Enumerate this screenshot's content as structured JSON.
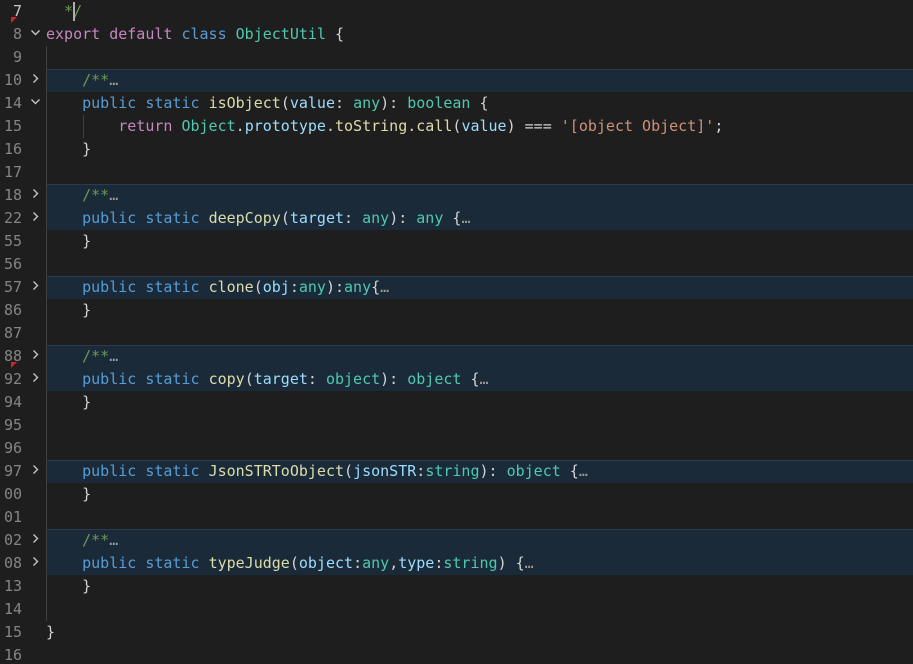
{
  "editor": {
    "language": "typescript",
    "colors": {
      "background": "#1e1e1e",
      "folded_highlight": "#1b2a38",
      "keyword": "#569cd6",
      "control": "#c586c0",
      "class": "#4ec9b0",
      "function": "#dcdcaa",
      "parameter": "#9cdcfe",
      "string": "#ce9178",
      "comment": "#6a9955",
      "line_number": "#858585"
    },
    "lines": [
      {
        "num": "7",
        "fold": "",
        "tokens": [
          [
            "cm",
            "  */"
          ]
        ]
      },
      {
        "num": "8",
        "fold": "expanded",
        "tokens": [
          [
            "ctl",
            "export"
          ],
          [
            "pun",
            " "
          ],
          [
            "ctl",
            "default"
          ],
          [
            "pun",
            " "
          ],
          [
            "kw",
            "class"
          ],
          [
            "pun",
            " "
          ],
          [
            "cls",
            "ObjectUtil"
          ],
          [
            "pun",
            " {"
          ]
        ]
      },
      {
        "num": "9",
        "fold": "",
        "tokens": []
      },
      {
        "num": "10",
        "fold": "collapsed",
        "tokens": [
          [
            "pun",
            "    "
          ],
          [
            "cm",
            "/**"
          ],
          [
            "ell",
            "…"
          ]
        ]
      },
      {
        "num": "14",
        "fold": "expanded",
        "tokens": [
          [
            "pun",
            "    "
          ],
          [
            "kw",
            "public"
          ],
          [
            "pun",
            " "
          ],
          [
            "kw",
            "static"
          ],
          [
            "pun",
            " "
          ],
          [
            "fn",
            "isObject"
          ],
          [
            "pun",
            "("
          ],
          [
            "par",
            "value"
          ],
          [
            "pun",
            ": "
          ],
          [
            "typ",
            "any"
          ],
          [
            "pun",
            "): "
          ],
          [
            "typ",
            "boolean"
          ],
          [
            "pun",
            " {"
          ]
        ]
      },
      {
        "num": "15",
        "fold": "",
        "tokens": [
          [
            "pun",
            "        "
          ],
          [
            "ctl",
            "return"
          ],
          [
            "pun",
            " "
          ],
          [
            "cls",
            "Object"
          ],
          [
            "pun",
            "."
          ],
          [
            "par",
            "prototype"
          ],
          [
            "pun",
            "."
          ],
          [
            "fn",
            "toString"
          ],
          [
            "pun",
            "."
          ],
          [
            "fn",
            "call"
          ],
          [
            "pun",
            "("
          ],
          [
            "par",
            "value"
          ],
          [
            "pun",
            ") === "
          ],
          [
            "str",
            "'[object Object]'"
          ],
          [
            "pun",
            ";"
          ]
        ]
      },
      {
        "num": "16",
        "fold": "",
        "tokens": [
          [
            "pun",
            "    }"
          ]
        ]
      },
      {
        "num": "17",
        "fold": "",
        "tokens": []
      },
      {
        "num": "18",
        "fold": "collapsed",
        "tokens": [
          [
            "pun",
            "    "
          ],
          [
            "cm",
            "/**"
          ],
          [
            "ell",
            "…"
          ]
        ]
      },
      {
        "num": "22",
        "fold": "collapsed",
        "tokens": [
          [
            "pun",
            "    "
          ],
          [
            "kw",
            "public"
          ],
          [
            "pun",
            " "
          ],
          [
            "kw",
            "static"
          ],
          [
            "pun",
            " "
          ],
          [
            "fn",
            "deepCopy"
          ],
          [
            "pun",
            "("
          ],
          [
            "par",
            "target"
          ],
          [
            "pun",
            ": "
          ],
          [
            "typ",
            "any"
          ],
          [
            "pun",
            "): "
          ],
          [
            "typ",
            "any"
          ],
          [
            "pun",
            " {"
          ],
          [
            "ell",
            "…"
          ]
        ]
      },
      {
        "num": "55",
        "fold": "",
        "tokens": [
          [
            "pun",
            "    }"
          ]
        ]
      },
      {
        "num": "56",
        "fold": "",
        "tokens": []
      },
      {
        "num": "57",
        "fold": "collapsed",
        "tokens": [
          [
            "pun",
            "    "
          ],
          [
            "kw",
            "public"
          ],
          [
            "pun",
            " "
          ],
          [
            "kw",
            "static"
          ],
          [
            "pun",
            " "
          ],
          [
            "fn",
            "clone"
          ],
          [
            "pun",
            "("
          ],
          [
            "par",
            "obj"
          ],
          [
            "pun",
            ":"
          ],
          [
            "typ",
            "any"
          ],
          [
            "pun",
            "):"
          ],
          [
            "typ",
            "any"
          ],
          [
            "pun",
            "{"
          ],
          [
            "ell",
            "…"
          ]
        ]
      },
      {
        "num": "86",
        "fold": "",
        "tokens": [
          [
            "pun",
            "    }"
          ]
        ]
      },
      {
        "num": "87",
        "fold": "",
        "tokens": []
      },
      {
        "num": "88",
        "fold": "collapsed",
        "tokens": [
          [
            "pun",
            "    "
          ],
          [
            "cm",
            "/**"
          ],
          [
            "ell",
            "…"
          ]
        ]
      },
      {
        "num": "92",
        "fold": "collapsed",
        "tokens": [
          [
            "pun",
            "    "
          ],
          [
            "kw",
            "public"
          ],
          [
            "pun",
            " "
          ],
          [
            "kw",
            "static"
          ],
          [
            "pun",
            " "
          ],
          [
            "fn",
            "copy"
          ],
          [
            "pun",
            "("
          ],
          [
            "par",
            "target"
          ],
          [
            "pun",
            ": "
          ],
          [
            "typ",
            "object"
          ],
          [
            "pun",
            "): "
          ],
          [
            "typ",
            "object"
          ],
          [
            "pun",
            " {"
          ],
          [
            "ell",
            "…"
          ]
        ]
      },
      {
        "num": "94",
        "fold": "",
        "tokens": [
          [
            "pun",
            "    }"
          ]
        ]
      },
      {
        "num": "95",
        "fold": "",
        "tokens": []
      },
      {
        "num": "96",
        "fold": "",
        "tokens": []
      },
      {
        "num": "97",
        "fold": "collapsed",
        "tokens": [
          [
            "pun",
            "    "
          ],
          [
            "kw",
            "public"
          ],
          [
            "pun",
            " "
          ],
          [
            "kw",
            "static"
          ],
          [
            "pun",
            " "
          ],
          [
            "fn",
            "JsonSTRToObject"
          ],
          [
            "pun",
            "("
          ],
          [
            "par",
            "jsonSTR"
          ],
          [
            "pun",
            ":"
          ],
          [
            "typ",
            "string"
          ],
          [
            "pun",
            "): "
          ],
          [
            "typ",
            "object"
          ],
          [
            "pun",
            " {"
          ],
          [
            "ell",
            "…"
          ]
        ]
      },
      {
        "num": "00",
        "fold": "",
        "tokens": [
          [
            "pun",
            "    }"
          ]
        ]
      },
      {
        "num": "01",
        "fold": "",
        "tokens": []
      },
      {
        "num": "02",
        "fold": "collapsed",
        "tokens": [
          [
            "pun",
            "    "
          ],
          [
            "cm",
            "/**"
          ],
          [
            "ell",
            "…"
          ]
        ]
      },
      {
        "num": "08",
        "fold": "collapsed",
        "tokens": [
          [
            "pun",
            "    "
          ],
          [
            "kw",
            "public"
          ],
          [
            "pun",
            " "
          ],
          [
            "kw",
            "static"
          ],
          [
            "pun",
            " "
          ],
          [
            "fn",
            "typeJudge"
          ],
          [
            "pun",
            "("
          ],
          [
            "par",
            "object"
          ],
          [
            "pun",
            ":"
          ],
          [
            "typ",
            "any"
          ],
          [
            "pun",
            ","
          ],
          [
            "par",
            "type"
          ],
          [
            "pun",
            ":"
          ],
          [
            "typ",
            "string"
          ],
          [
            "pun",
            ") {"
          ],
          [
            "ell",
            "…"
          ]
        ]
      },
      {
        "num": "13",
        "fold": "",
        "tokens": [
          [
            "pun",
            "    }"
          ]
        ]
      },
      {
        "num": "14",
        "fold": "",
        "tokens": []
      },
      {
        "num": "15",
        "fold": "",
        "tokens": [
          [
            "pun",
            "}"
          ]
        ]
      },
      {
        "num": "16",
        "fold": "",
        "tokens": []
      }
    ],
    "highlighted_lines": [
      3,
      8,
      9,
      12,
      15,
      16,
      20,
      23,
      24
    ],
    "highlight_groups_top": [
      3,
      8,
      12,
      15,
      20,
      23
    ],
    "error_marker_lines": [
      0,
      15
    ],
    "active_line": 0
  }
}
